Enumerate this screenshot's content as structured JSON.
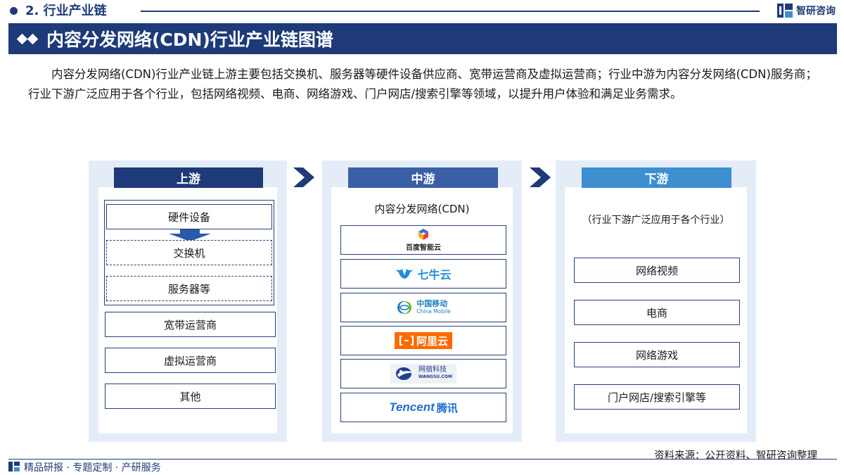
{
  "section": {
    "title": "2. 行业产业链"
  },
  "brand": {
    "name": "智研咨询",
    "icon": "zhiyan-logo-icon"
  },
  "banner": {
    "title": "内容分发网络(CDN)行业产业链图谱"
  },
  "intro": "内容分发网络(CDN)行业产业链上游主要包括交换机、服务器等硬件设备供应商、宽带运营商及虚拟运营商；行业中游为内容分发网络(CDN)服务商；行业下游广泛应用于各个行业，包括网络视频、电商、网络游戏、门户网店/搜索引擎等领域，以提升用户体验和满足业务需求。",
  "upstream": {
    "header": "上游",
    "header_color": "#1e3a78",
    "hardware": {
      "label": "硬件设备",
      "children": [
        "交换机",
        "服务器等"
      ]
    },
    "items": [
      "宽带运营商",
      "虚拟运营商",
      "其他"
    ]
  },
  "midstream": {
    "header": "中游",
    "header_color": "#3a5fa6",
    "subtitle": "内容分发网络(CDN)",
    "logos": [
      {
        "name": "百度智能云",
        "icon": "baidu-ai-cloud-logo"
      },
      {
        "name": "七牛云",
        "icon": "qiniu-cloud-logo"
      },
      {
        "name": "中国移动",
        "sub": "China Mobile",
        "icon": "china-mobile-logo"
      },
      {
        "name": "阿里云",
        "icon": "aliyun-logo"
      },
      {
        "name": "网宿科技",
        "sub": "WANGSU.COM",
        "icon": "wangsu-logo"
      },
      {
        "name": "Tencent",
        "cn": "腾讯",
        "icon": "tencent-logo"
      }
    ]
  },
  "downstream": {
    "header": "下游",
    "header_color": "#3d8fd0",
    "subtitle": "（行业下游广泛应用于各个行业）",
    "items": [
      "网络视频",
      "电商",
      "网络游戏",
      "门户网店/搜索引擎等"
    ]
  },
  "footer": {
    "source": "资料来源：公开资料、智研咨询整理",
    "slogan": "精品研报 · 专题定制 · 产研服务"
  },
  "colors": {
    "primary": "#1e3a78",
    "panel_bg": "#e4ecf8",
    "aliyun_orange": "#ff6a00",
    "tencent_blue": "#1e6fd0",
    "mobile_blue": "#1a7fc1",
    "mobile_green": "#6bb82d"
  }
}
